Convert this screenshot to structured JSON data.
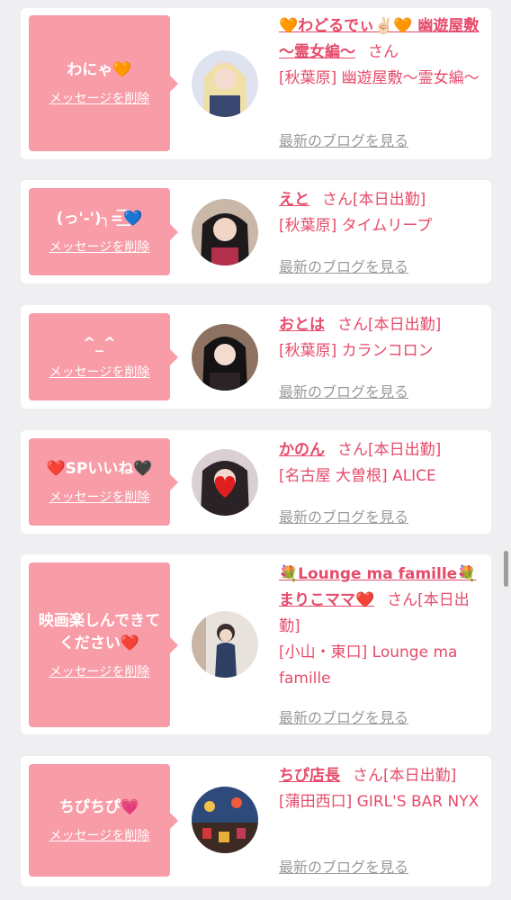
{
  "delete_label": "メッセージを削除",
  "blog_label": "最新のブログを見る",
  "san": "さん",
  "cards": [
    {
      "message": "わにゃ🧡",
      "name": "🧡わどるでぃ✌🏻🧡 幽遊屋敷 〜霊女編〜",
      "san_suffix": "",
      "shop": "[秋葉原] 幽遊屋敷〜霊女編〜"
    },
    {
      "message": "(っ'-')╮=͟͟͞͞💙",
      "name": "えと",
      "san_suffix": "[本日出勤]",
      "shop": "[秋葉原] タイムリープ"
    },
    {
      "message": "^_^",
      "name": "おとは",
      "san_suffix": "[本日出勤]",
      "shop": "[秋葉原] カランコロン"
    },
    {
      "message": "❤️SPいいね🖤",
      "name": "かのん",
      "san_suffix": "[本日出勤]",
      "shop": "[名古屋 大曽根] ALICE"
    },
    {
      "message": "映画楽しんできてください❤️",
      "name": "💐Lounge ma famille💐まりこママ❤️",
      "san_suffix": "[本日出勤]",
      "shop": "[小山・東口] Lounge ma famille"
    },
    {
      "message": "ちぴちぴ💗",
      "name": "ちぴ店長",
      "san_suffix": "[本日出勤]",
      "shop": "[蒲田西口] GIRL'S BAR NYX"
    }
  ],
  "colors": {
    "accent": "#e64b6a",
    "bubble": "#f89ca7",
    "background": "#efeff1"
  }
}
